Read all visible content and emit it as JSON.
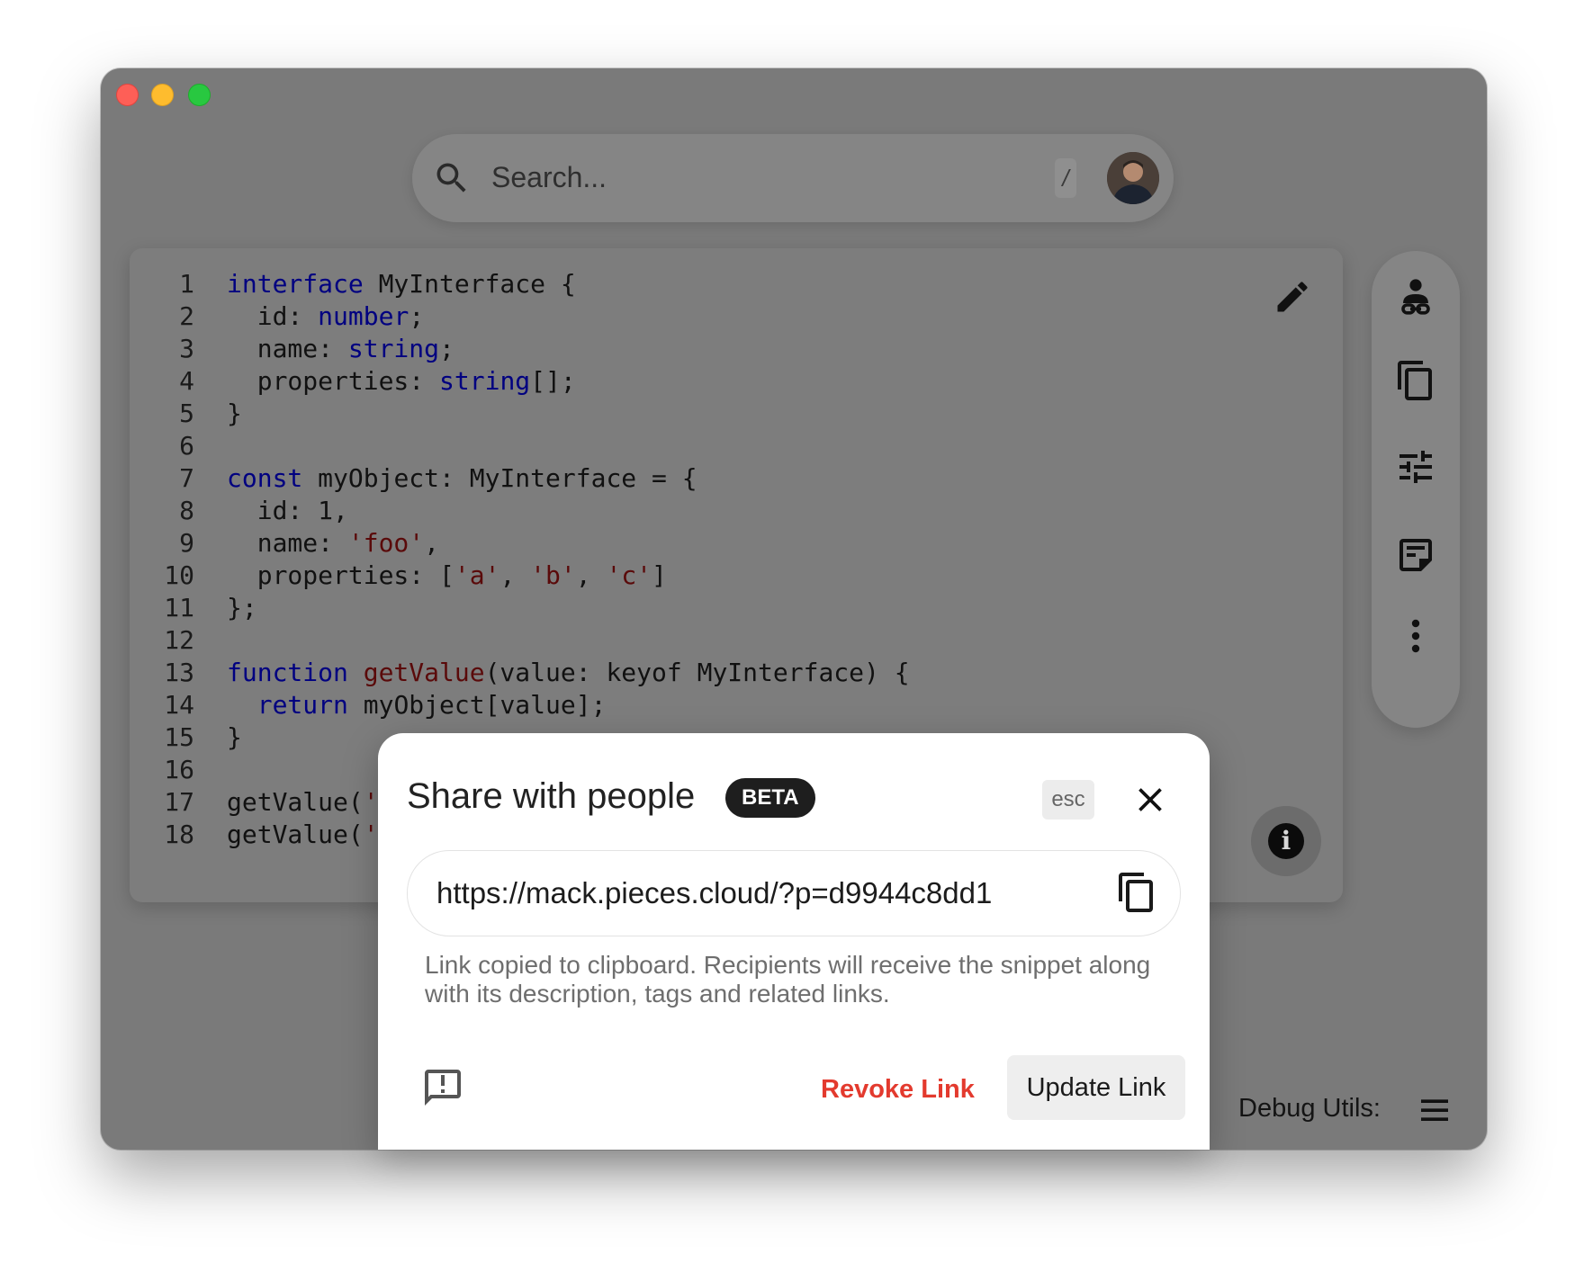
{
  "window": {
    "traffic_lights": [
      "close",
      "minimize",
      "maximize"
    ]
  },
  "search": {
    "placeholder": "Search...",
    "shortcut": "/"
  },
  "editor": {
    "lines": [
      {
        "n": "1",
        "html": "<span class=\"kw\">interface</span> MyInterface {"
      },
      {
        "n": "2",
        "html": "  id: <span class=\"kw\">number</span>;"
      },
      {
        "n": "3",
        "html": "  name: <span class=\"kw\">string</span>;"
      },
      {
        "n": "4",
        "html": "  properties: <span class=\"kw\">string</span>[];"
      },
      {
        "n": "5",
        "html": "}"
      },
      {
        "n": "6",
        "html": ""
      },
      {
        "n": "7",
        "html": "<span class=\"kw\">const</span> myObject: MyInterface = {"
      },
      {
        "n": "8",
        "html": "  id: 1,"
      },
      {
        "n": "9",
        "html": "  name: <span class=\"str\">'foo'</span>,"
      },
      {
        "n": "10",
        "html": "  properties: [<span class=\"str\">'a'</span>, <span class=\"str\">'b'</span>, <span class=\"str\">'c'</span>]"
      },
      {
        "n": "11",
        "html": "};"
      },
      {
        "n": "12",
        "html": ""
      },
      {
        "n": "13",
        "html": "<span class=\"kw\">function</span> <span class=\"fn\">getValue</span>(value: keyof MyInterface) {"
      },
      {
        "n": "14",
        "html": "  <span class=\"kw\">return</span> myObject[value];"
      },
      {
        "n": "15",
        "html": "}"
      },
      {
        "n": "16",
        "html": ""
      },
      {
        "n": "17",
        "html": "getValue(<span class=\"str\">'i</span>"
      },
      {
        "n": "18",
        "html": "getValue(<span class=\"str\">'n</span>"
      }
    ]
  },
  "side_rail": {
    "icons": [
      "share-person-icon",
      "copy-icon",
      "tune-icon",
      "note-icon",
      "more-vert-icon"
    ]
  },
  "footer": {
    "debug_label": "Debug Utils:"
  },
  "share_dialog": {
    "title": "Share with people",
    "badge": "BETA",
    "esc_label": "esc",
    "link": "https://mack.pieces.cloud/?p=d9944c8dd1",
    "description": "Link copied to clipboard. Recipients will receive the snippet along with its description, tags and related links.",
    "revoke_label": "Revoke Link",
    "update_label": "Update Link"
  },
  "colors": {
    "accent_danger": "#e33a2e",
    "keyword": "#000080",
    "string": "#5a0a0a",
    "overlay": "#7a7a7a"
  }
}
